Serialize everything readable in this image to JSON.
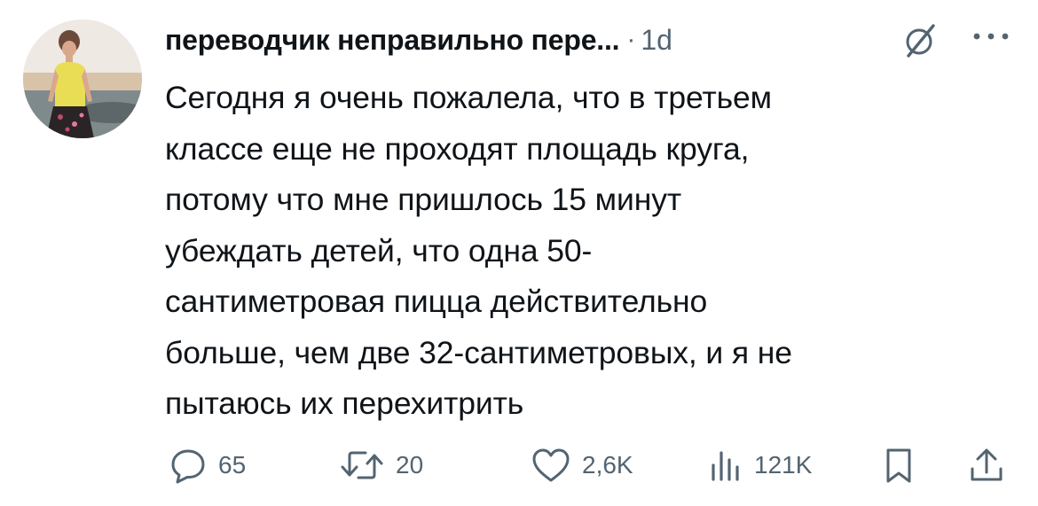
{
  "post": {
    "author": "переводчик неправильно пере...",
    "separator": "·",
    "time": "1d",
    "text": "Сегодня я очень пожалела, что в третьем\nклассе еще не проходят площадь круга,\nпотому что мне пришлось 15 минут\nубеждать детей, что одна 50-\nсантиметровая пицца действительно\nбольше, чем две 32-сантиметровых, и я не\nпытаюсь их перехитрить"
  },
  "icons": {
    "grok": "grok-slash-icon",
    "more": "more-dots-icon",
    "reply": "reply-bubble-icon",
    "retweet": "retweet-icon",
    "like": "heart-icon",
    "views": "views-bar-icon",
    "bookmark": "bookmark-icon",
    "share": "share-icon"
  },
  "actions": {
    "replies": "65",
    "reposts": "20",
    "likes": "2,6K",
    "views": "121K"
  },
  "colors": {
    "text": "#0f1419",
    "secondary": "#536471",
    "background": "#ffffff"
  }
}
